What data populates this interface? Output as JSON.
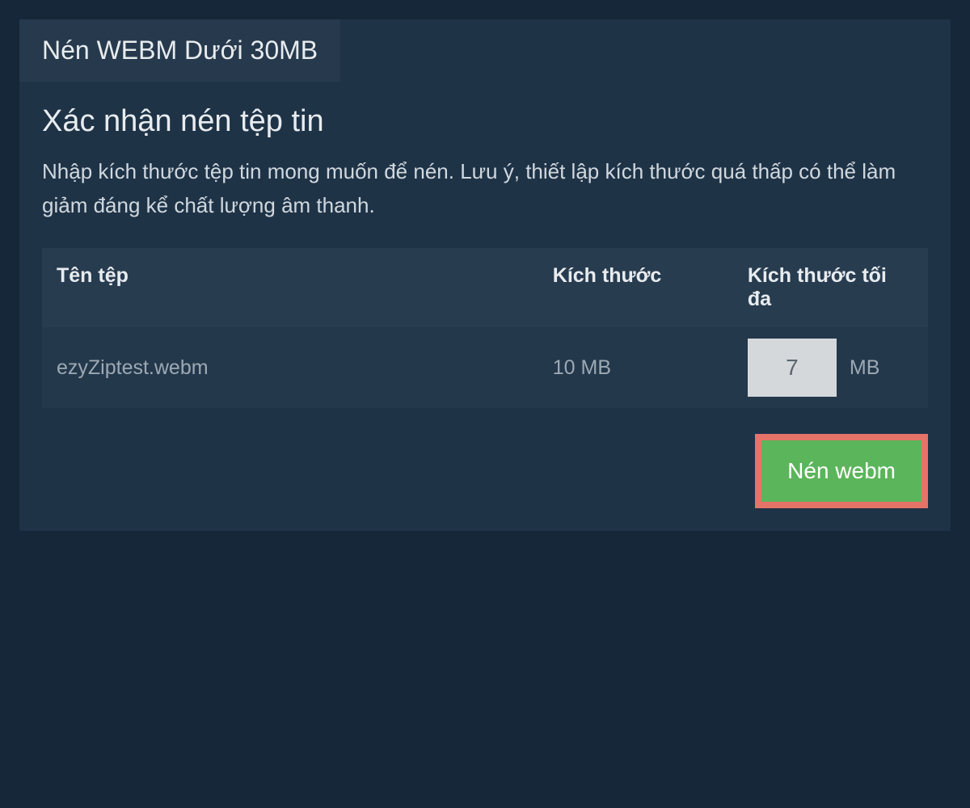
{
  "tab": {
    "label": "Nén WEBM Dưới 30MB"
  },
  "heading": "Xác nhận nén tệp tin",
  "description": "Nhập kích thước tệp tin mong muốn để nén. Lưu ý, thiết lập kích thước quá thấp có thể làm giảm đáng kể chất lượng âm thanh.",
  "table": {
    "headers": {
      "filename": "Tên tệp",
      "size": "Kích thước",
      "maxSize": "Kích thước tối đa"
    },
    "rows": [
      {
        "filename": "ezyZiptest.webm",
        "size": "10 MB",
        "maxSizeValue": "7",
        "maxSizeUnit": "MB"
      }
    ]
  },
  "compressButton": {
    "label": "Nén webm"
  }
}
